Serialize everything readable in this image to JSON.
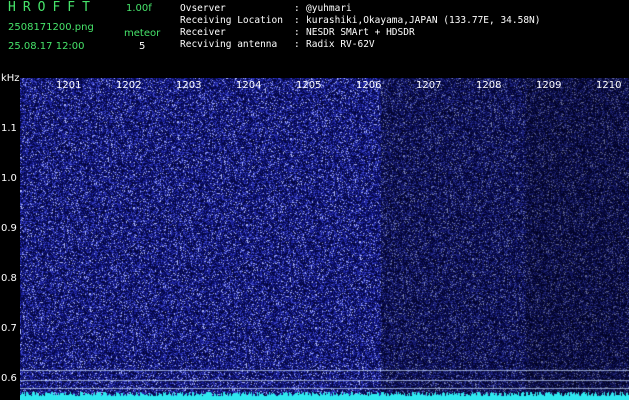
{
  "header": {
    "logo": "HROFFT",
    "version": "1.00f",
    "filename": "2508171200.png",
    "datetime": "25.08.17 12:00",
    "meteor_label": "meteor",
    "meteor_count": "5"
  },
  "info": {
    "keys": [
      "Ovserver",
      "Receiving Location",
      "Receiver",
      "Recviving antenna"
    ],
    "values": [
      "@yuhmari",
      "kurashiki,Okayama,JAPAN (133.77E, 34.58N)",
      "NESDR SMArt + HDSDR",
      "Radix RV-62V"
    ]
  },
  "axes": {
    "y_unit": "kHz",
    "x_ticks": [
      "1201",
      "1202",
      "1203",
      "1204",
      "1205",
      "1206",
      "1207",
      "1208",
      "1209",
      "1210"
    ],
    "y_ticks": [
      "1.1",
      "1.0",
      "0.9",
      "0.8",
      "0.7",
      "0.6"
    ]
  },
  "colors": {
    "background": "#000000",
    "spectrum_base": "#1a1f8c",
    "noise_points": "#aab4ff",
    "power_trace": "#2fe8f0",
    "header_green": "#46e46a"
  }
}
